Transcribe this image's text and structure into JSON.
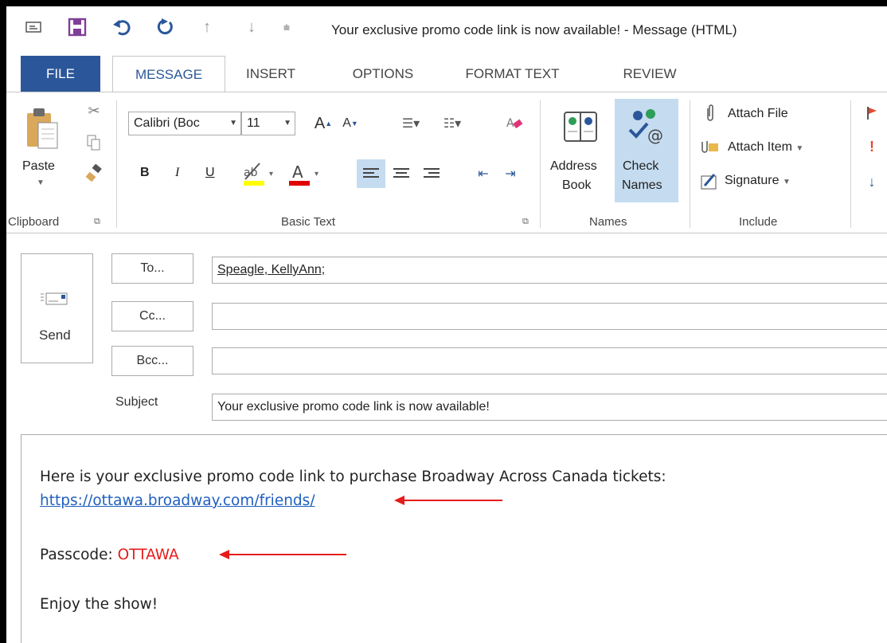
{
  "window": {
    "title": "Your exclusive promo code link is now available!  - Message (HTML)"
  },
  "tabs": {
    "file": "FILE",
    "message": "MESSAGE",
    "insert": "INSERT",
    "options": "OPTIONS",
    "format_text": "FORMAT TEXT",
    "review": "REVIEW"
  },
  "ribbon": {
    "clipboard": {
      "paste_label": "Paste",
      "group_label": "Clipboard"
    },
    "basic_text": {
      "font_name": "Calibri (Boc",
      "font_size": "11",
      "bold": "B",
      "italic": "I",
      "underline": "U",
      "group_label": "Basic Text"
    },
    "names": {
      "address_book_line1": "Address",
      "address_book_line2": "Book",
      "check_names_line1": "Check",
      "check_names_line2": "Names",
      "group_label": "Names"
    },
    "include": {
      "attach_file": "Attach File",
      "attach_item": "Attach Item",
      "signature": "Signature",
      "group_label": "Include"
    }
  },
  "header": {
    "send_label": "Send",
    "to_button": "To...",
    "cc_button": "Cc...",
    "bcc_button": "Bcc...",
    "to_value": "Speagle, KellyAnn;",
    "cc_value": "",
    "bcc_value": "",
    "subject_label": "Subject",
    "subject_value": "Your exclusive promo code link is now available!"
  },
  "message": {
    "line1": "Here is your exclusive promo code link to purchase Broadway Across Canada tickets:",
    "link": "https://ottawa.broadway.com/friends/",
    "passcode_label": "Passcode: ",
    "passcode_value": "OTTAWA",
    "closing": "Enjoy the show!"
  },
  "colors": {
    "accent": "#2b579a",
    "link": "#1f5fbf",
    "passcode": "#e81b1b",
    "annotation_arrow": "#e81b1b"
  }
}
